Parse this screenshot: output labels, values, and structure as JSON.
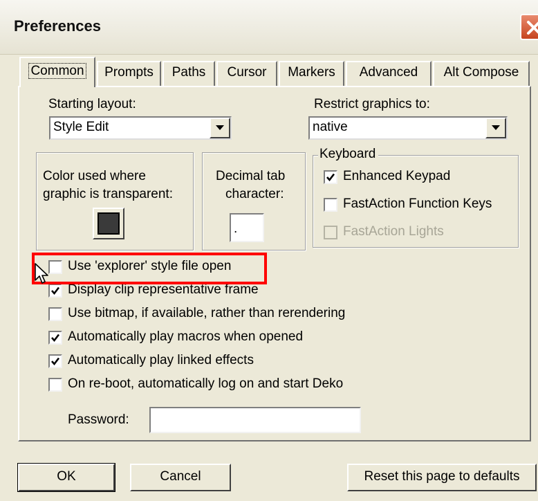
{
  "window": {
    "title": "Preferences"
  },
  "tabs": [
    {
      "label": "Common",
      "active": true
    },
    {
      "label": "Prompts"
    },
    {
      "label": "Paths"
    },
    {
      "label": "Cursor"
    },
    {
      "label": "Markers"
    },
    {
      "label": "Advanced"
    },
    {
      "label": "Alt Compose"
    }
  ],
  "common": {
    "starting_layout_label": "Starting layout:",
    "starting_layout_value": "Style Edit",
    "restrict_graphics_label": "Restrict graphics to:",
    "restrict_graphics_value": "native",
    "color_transparent_label_1": "Color used where",
    "color_transparent_label_2": "graphic is transparent:",
    "transparent_color": "#3a3a3a",
    "decimal_tab_label_1": "Decimal tab",
    "decimal_tab_label_2": "character:",
    "decimal_tab_value": ".",
    "keyboard": {
      "title": "Keyboard",
      "enhanced_keypad": {
        "label": "Enhanced Keypad",
        "checked": true
      },
      "fastaction_function_keys": {
        "label": "FastAction Function Keys",
        "checked": false
      },
      "fastaction_lights": {
        "label": "FastAction Lights",
        "checked": false,
        "disabled": true
      }
    },
    "options": [
      {
        "label": "Use 'explorer' style file open",
        "checked": false
      },
      {
        "label": "Display clip representative frame",
        "checked": true
      },
      {
        "label": "Use bitmap, if available, rather than rerendering",
        "checked": false
      },
      {
        "label": "Automatically play macros when opened",
        "checked": true
      },
      {
        "label": "Automatically play linked effects",
        "checked": true
      },
      {
        "label": "On re-boot, automatically log on and start Deko",
        "checked": false
      }
    ],
    "password_label": "Password:",
    "password_value": ""
  },
  "buttons": {
    "ok": "OK",
    "cancel": "Cancel",
    "reset": "Reset this page to defaults"
  },
  "colors": {
    "highlight": "#ff0000",
    "dialog_bg": "#ece9d8",
    "close_button": "#d35a37"
  }
}
